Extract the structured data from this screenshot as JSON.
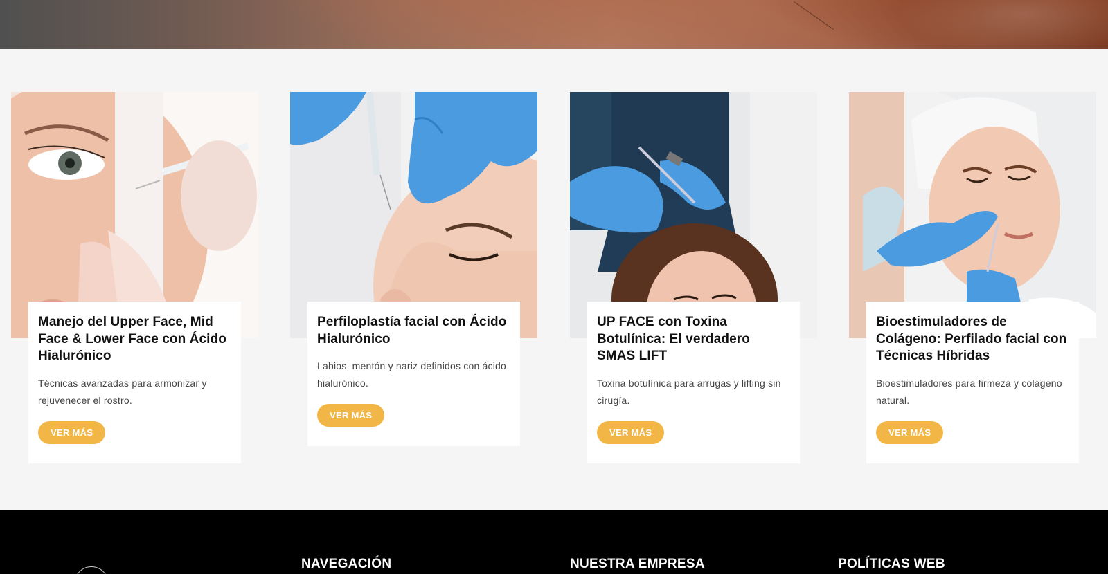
{
  "cards": [
    {
      "title": "Manejo del Upper Face, Mid Face & Lower Face con Ácido Hialurónico",
      "description": "Técnicas avanzadas para armonizar y rejuvenecer el rostro.",
      "button_label": "VER MÁS"
    },
    {
      "title": "Perfiloplastía facial con Ácido Hialurónico",
      "description": "Labios, mentón y nariz definidos con ácido hialurónico.",
      "button_label": "VER MÁS"
    },
    {
      "title": "UP FACE con Toxina Botulínica: El verdadero SMAS LIFT",
      "description": "Toxina botulínica para arrugas y lifting sin cirugía.",
      "button_label": "VER MÁS"
    },
    {
      "title": "Bioestimuladores de Colágeno: Perfilado facial con Técnicas Híbridas",
      "description": "Bioestimuladores para firmeza y colágeno natural.",
      "button_label": "VER MÁS"
    }
  ],
  "footer": {
    "columns": [
      "NAVEGACIÓN",
      "NUESTRA EMPRESA",
      "POLÍTICAS WEB"
    ]
  },
  "colors": {
    "accent": "#f1b645",
    "page_bg": "#f5f5f5",
    "footer_bg": "#000000",
    "glove_blue": "#4a9be0"
  }
}
